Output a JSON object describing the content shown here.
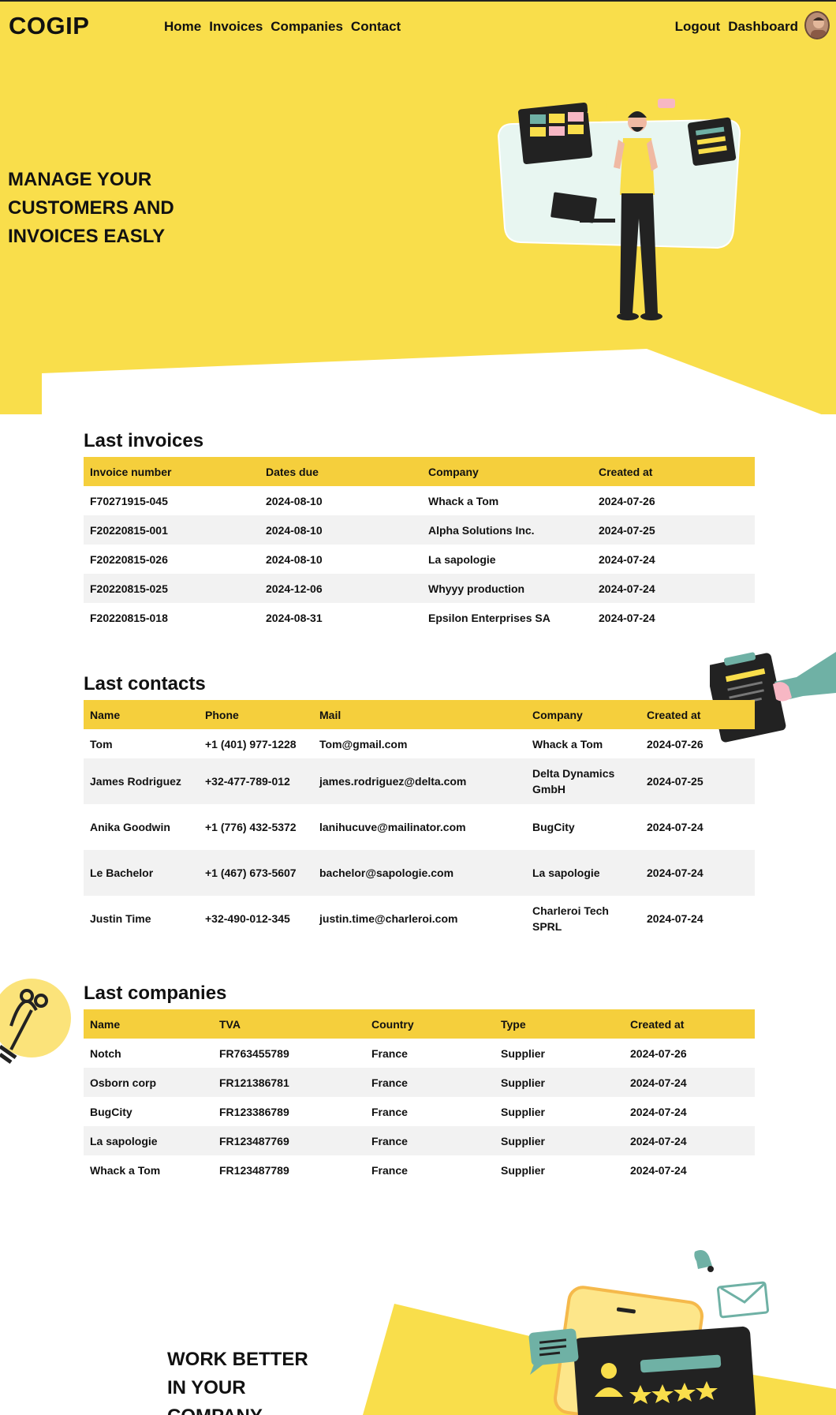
{
  "brand": {
    "logo": "COGIP"
  },
  "nav": {
    "home": "Home",
    "invoices": "Invoices",
    "companies": "Companies",
    "contact": "Contact",
    "logout": "Logout",
    "dashboard": "Dashboard"
  },
  "hero": {
    "line1": "MANAGE YOUR",
    "line2": "CUSTOMERS AND",
    "line3": "INVOICES EASLY"
  },
  "invoices": {
    "title": "Last invoices",
    "headers": [
      "Invoice number",
      "Dates due",
      "Company",
      "Created at"
    ],
    "rows": [
      [
        "F70271915-045",
        "2024-08-10",
        "Whack a Tom",
        "2024-07-26"
      ],
      [
        "F20220815-001",
        "2024-08-10",
        "Alpha Solutions Inc.",
        "2024-07-25"
      ],
      [
        "F20220815-026",
        "2024-08-10",
        "La sapologie",
        "2024-07-24"
      ],
      [
        "F20220815-025",
        "2024-12-06",
        "Whyyy production",
        "2024-07-24"
      ],
      [
        "F20220815-018",
        "2024-08-31",
        "Epsilon Enterprises SA",
        "2024-07-24"
      ]
    ]
  },
  "contacts": {
    "title": "Last contacts",
    "headers": [
      "Name",
      "Phone",
      "Mail",
      "Company",
      "Created at"
    ],
    "rows": [
      [
        "Tom",
        "+1 (401) 977-1228",
        "Tom@gmail.com",
        "Whack a Tom",
        "2024-07-26"
      ],
      [
        "James Rodriguez",
        "+32-477-789-012",
        "james.rodriguez@delta.com",
        "Delta Dynamics GmbH",
        "2024-07-25"
      ],
      [
        "Anika Goodwin",
        "+1 (776) 432-5372",
        "lanihucuve@mailinator.com",
        "BugCity",
        "2024-07-24"
      ],
      [
        "Le Bachelor",
        "+1 (467) 673-5607",
        "bachelor@sapologie.com",
        "La sapologie",
        "2024-07-24"
      ],
      [
        "Justin Time",
        "+32-490-012-345",
        "justin.time@charleroi.com",
        "Charleroi Tech SPRL",
        "2024-07-24"
      ]
    ]
  },
  "companies": {
    "title": "Last companies",
    "headers": [
      "Name",
      "TVA",
      "Country",
      "Type",
      "Created at"
    ],
    "rows": [
      [
        "Notch",
        "FR763455789",
        "France",
        "Supplier",
        "2024-07-26"
      ],
      [
        "Osborn corp",
        "FR121386781",
        "France",
        "Supplier",
        "2024-07-24"
      ],
      [
        "BugCity",
        "FR123386789",
        "France",
        "Supplier",
        "2024-07-24"
      ],
      [
        "La sapologie",
        "FR123487769",
        "France",
        "Supplier",
        "2024-07-24"
      ],
      [
        "Whack a Tom",
        "FR123487789",
        "France",
        "Supplier",
        "2024-07-24"
      ]
    ]
  },
  "footer": {
    "line1": "WORK BETTER",
    "line2": "IN YOUR",
    "line3": "COMPANY"
  },
  "colors": {
    "yellow": "#f9de4b",
    "header_yellow": "#f5cf3c",
    "teal": "#6fb1a5",
    "dark": "#222"
  },
  "icons": [
    "avatar",
    "hero-illustration",
    "clipboard-illustration",
    "lightbulb-illustration",
    "bell-icon",
    "mail-icon",
    "review-card-illustration"
  ]
}
